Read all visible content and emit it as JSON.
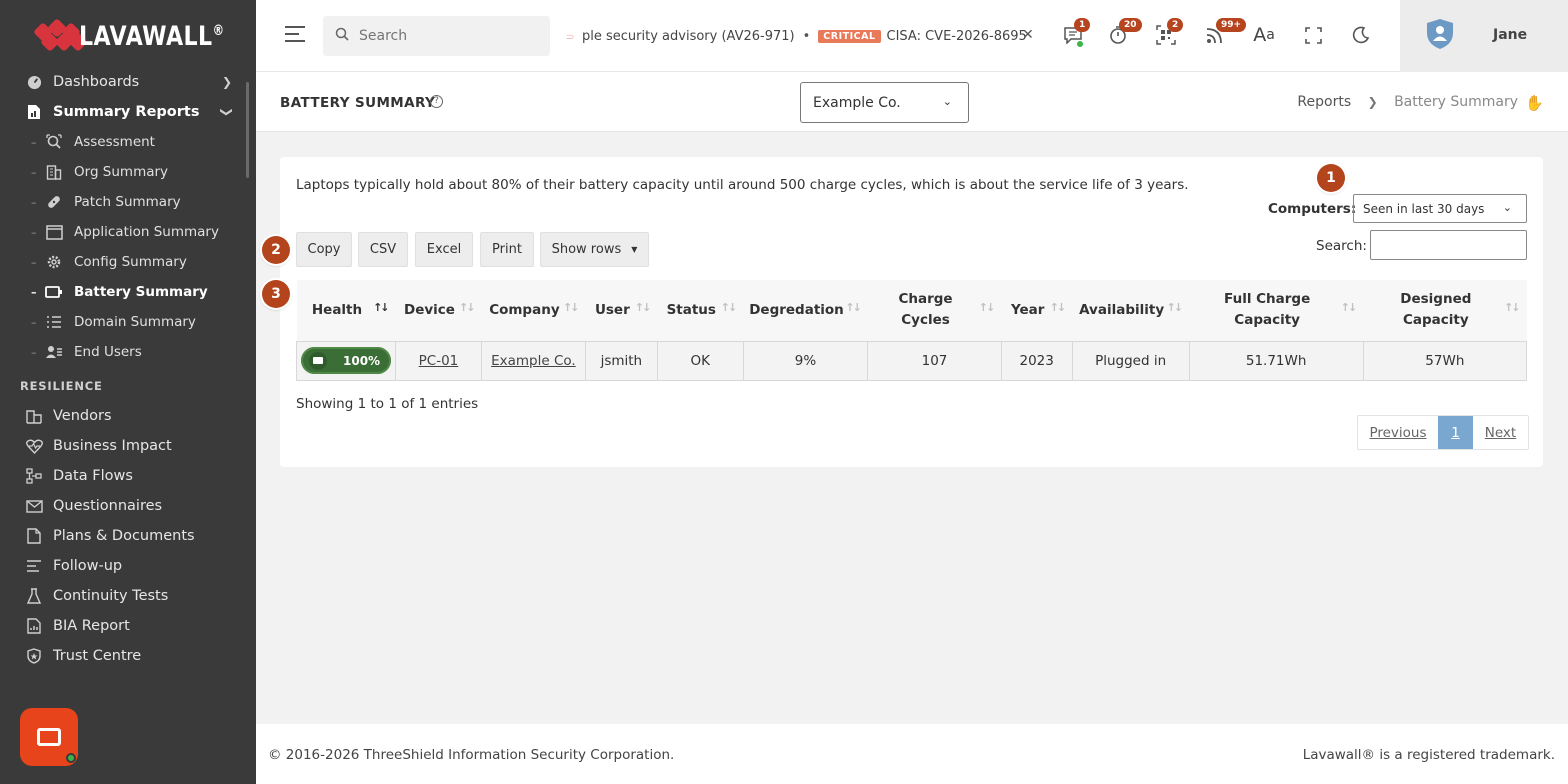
{
  "brand": {
    "name": "LAVAWALL",
    "reg": "®"
  },
  "sidebar": {
    "items": [
      {
        "label": "Dashboards",
        "icon": "gauge-icon"
      },
      {
        "label": "Summary Reports",
        "icon": "report-icon"
      }
    ],
    "sub_items": [
      {
        "label": "Assessment",
        "icon": "assessment-icon"
      },
      {
        "label": "Org Summary",
        "icon": "building-icon"
      },
      {
        "label": "Patch Summary",
        "icon": "bandage-icon"
      },
      {
        "label": "Application Summary",
        "icon": "window-icon"
      },
      {
        "label": "Config Summary",
        "icon": "gear-icon"
      },
      {
        "label": "Battery Summary",
        "icon": "battery-icon"
      },
      {
        "label": "Domain Summary",
        "icon": "list-icon"
      },
      {
        "label": "End Users",
        "icon": "users-icon"
      }
    ],
    "section": "RESILIENCE",
    "resilience": [
      {
        "label": "Vendors",
        "icon": "vendor-icon"
      },
      {
        "label": "Business Impact",
        "icon": "heart-pulse-icon"
      },
      {
        "label": "Data Flows",
        "icon": "flow-icon"
      },
      {
        "label": "Questionnaires",
        "icon": "envelope-icon"
      },
      {
        "label": "Plans & Documents",
        "icon": "document-icon"
      },
      {
        "label": "Follow-up",
        "icon": "checklist-icon"
      },
      {
        "label": "Continuity Tests",
        "icon": "flask-icon"
      },
      {
        "label": "BIA Report",
        "icon": "chart-icon"
      },
      {
        "label": "Trust Centre",
        "icon": "shield-star-icon"
      }
    ]
  },
  "topbar": {
    "search_placeholder": "Search",
    "ticker_1": "ple security advisory (AV26-971)",
    "ticker_badge": "CRITICAL",
    "ticker_2": "CISA: CVE-2026-8695",
    "badges": {
      "messages": "1",
      "timer": "20",
      "qr": "2",
      "feed": "99+"
    },
    "user": "Jane"
  },
  "page": {
    "title": "BATTERY SUMMARY",
    "company": "Example Co.",
    "breadcrumb": [
      "Reports",
      "Battery Summary"
    ]
  },
  "card": {
    "info": "Laptops typically hold about 80% of their battery capacity until around 500 charge cycles, which is about the service life of 3 years.",
    "computers_label": "Computers:",
    "computers_value": "Seen in last 30 days",
    "search_label": "Search:",
    "buttons": {
      "copy": "Copy",
      "csv": "CSV",
      "excel": "Excel",
      "print": "Print",
      "show_rows": "Show rows"
    },
    "markers": [
      "1",
      "2",
      "3"
    ],
    "columns": [
      "Health",
      "Device",
      "Company",
      "User",
      "Status",
      "Degredation",
      "Charge Cycles",
      "Year",
      "Availability",
      "Full Charge Capacity",
      "Designed Capacity"
    ],
    "rows": [
      {
        "health": "100%",
        "device": "PC-01",
        "company": "Example Co.",
        "user": "jsmith",
        "status": "OK",
        "degredation": "9%",
        "cycles": "107",
        "year": "2023",
        "availability": "Plugged in",
        "full": "51.71Wh",
        "designed": "57Wh"
      }
    ],
    "showing": "Showing 1 to 1 of 1 entries",
    "pager": {
      "prev": "Previous",
      "page": "1",
      "next": "Next"
    }
  },
  "footer": {
    "copyright": "© 2016-2026 ThreeShield Information Security Corporation.",
    "trademark": "Lavawall® is a registered trademark."
  },
  "colors": {
    "sidebar": "#3a3a3a",
    "accent": "#b3441b",
    "health": "#3b6e37",
    "page_active": "#7aa7cf"
  }
}
